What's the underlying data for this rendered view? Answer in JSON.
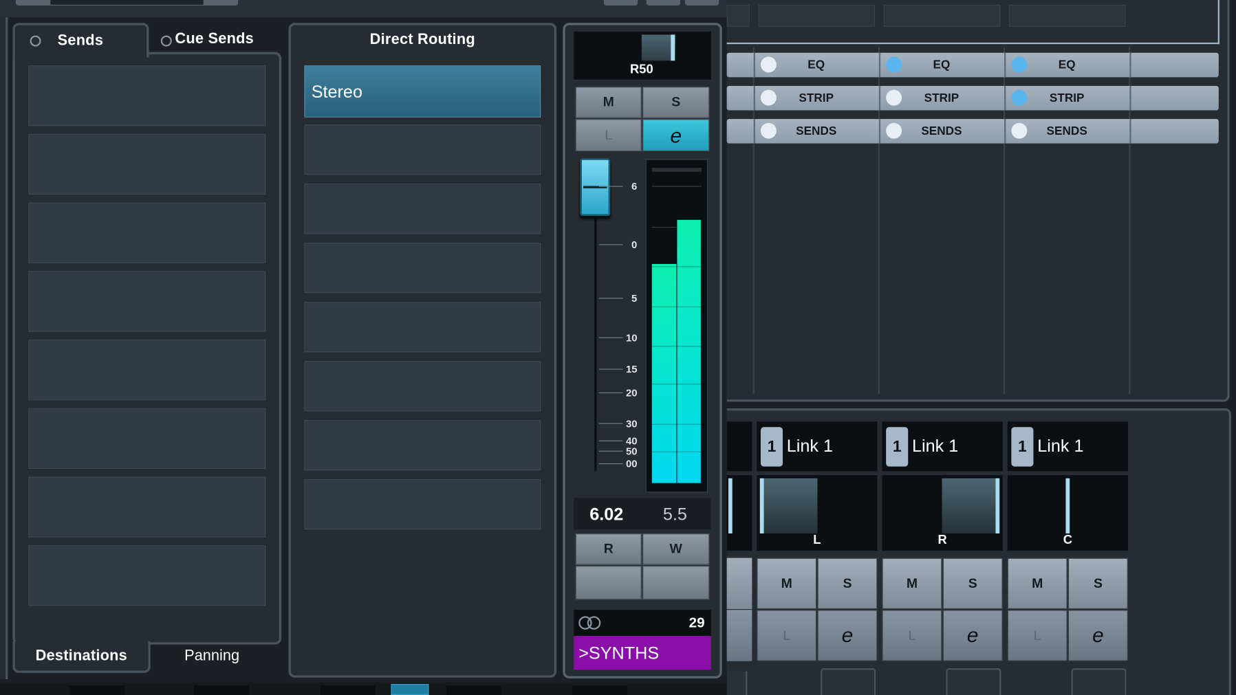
{
  "left_panel": {
    "tabs": [
      {
        "label": "Sends",
        "active": true
      },
      {
        "label": "Cue Sends",
        "active": false
      }
    ],
    "bottom_tabs": [
      {
        "label": "Destinations",
        "active": true
      },
      {
        "label": "Panning",
        "active": false
      }
    ],
    "send_slots_count": 8
  },
  "routing_panel": {
    "title": "Direct Routing",
    "slots": [
      "Stereo",
      "",
      "",
      "",
      "",
      "",
      "",
      ""
    ]
  },
  "channel_strip": {
    "pan_label": "R50",
    "buttons": {
      "mute": "M",
      "solo": "S",
      "listen": "L",
      "edit": "e",
      "read": "R",
      "write": "W"
    },
    "fader_scale": [
      "6",
      "0",
      "5",
      "10",
      "15",
      "20",
      "30",
      "40",
      "50",
      "00"
    ],
    "volume_value": "6.02",
    "meter_peak": "5.5",
    "meter_levels": {
      "left": 0.745,
      "right": 0.895
    },
    "channel_number": "29",
    "channel_name": ">SYNTHS",
    "name_color": "#8a0fa8"
  },
  "right_section": {
    "rack_rows": [
      "EQ",
      "STRIP",
      "SENDS"
    ],
    "channels": [
      {
        "leds": [
          "off",
          "off",
          "off"
        ],
        "link_num": "1",
        "link_label": "Link 1",
        "pan_label": "L",
        "pan": -1,
        "mute": "M",
        "solo": "S",
        "listen": "L",
        "edit": "e"
      },
      {
        "leds": [
          "on",
          "off",
          "off"
        ],
        "link_num": "1",
        "link_label": "Link 1",
        "pan_label": "R",
        "pan": 1,
        "mute": "M",
        "solo": "S",
        "listen": "L",
        "edit": "e"
      },
      {
        "leds": [
          "on",
          "on",
          "off"
        ],
        "link_num": "1",
        "link_label": "Link 1",
        "pan_label": "C",
        "pan": 0,
        "mute": "M",
        "solo": "S",
        "listen": "L",
        "edit": "e"
      }
    ]
  },
  "colors": {
    "accent_cyan": "#2fbfd8",
    "selected_slot": "#2e6a85",
    "meter_green": "#0ff0b0",
    "led_on": "#5ab4ee",
    "led_off": "#e8eef3"
  }
}
